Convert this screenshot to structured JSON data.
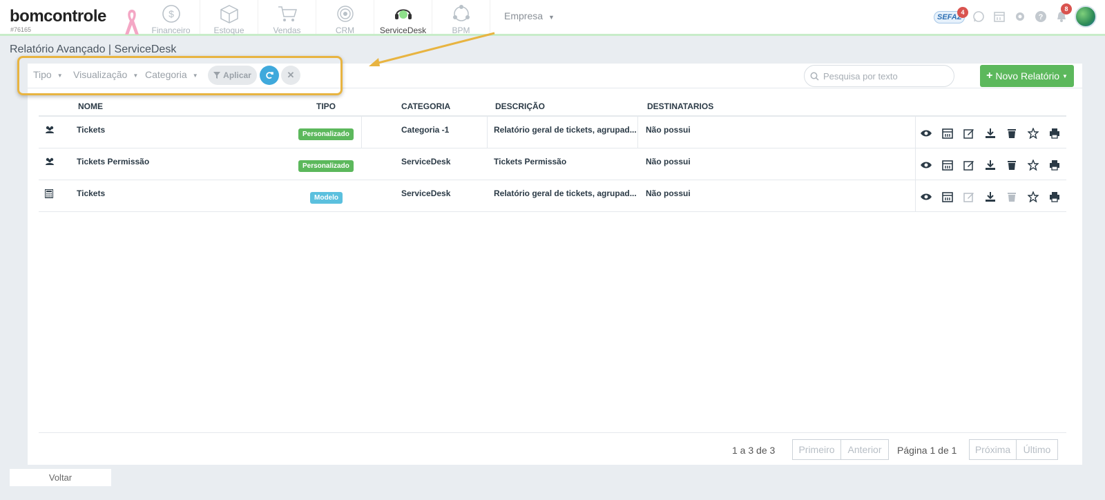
{
  "app": {
    "logo": "bomcontrole",
    "account_id": "#76165"
  },
  "modules": [
    {
      "label": "Financeiro",
      "icon": "dollar-coin-icon"
    },
    {
      "label": "Estoque",
      "icon": "box-icon"
    },
    {
      "label": "Vendas",
      "icon": "shopping-cart-icon"
    },
    {
      "label": "CRM",
      "icon": "target-icon"
    },
    {
      "label": "ServiceDesk",
      "icon": "headset-icon",
      "active": true
    },
    {
      "label": "BPM",
      "icon": "process-circle-icon"
    }
  ],
  "company_menu": "Empresa",
  "header_icons": {
    "sefaz_label": "SEFAZ",
    "sefaz_badge": "4",
    "notifications_badge": "8"
  },
  "page": {
    "title": "Relatório Avançado | ServiceDesk"
  },
  "toolbar": {
    "filters": [
      "Tipo",
      "Visualização",
      "Categoria"
    ],
    "apply_label": "Aplicar",
    "search_placeholder": "Pesquisa por texto",
    "new_report_label": "Novo Relatório"
  },
  "table": {
    "headers": {
      "name": "NOME",
      "type": "TIPO",
      "category": "CATEGORIA",
      "description": "DESCRIÇÃO",
      "recipients": "DESTINATARIOS"
    },
    "rows": [
      {
        "name": "Tickets",
        "type": "Personalizado",
        "category": "Categoria -1",
        "description": "Relatório geral de tickets, agrupad...",
        "recipients": "Não possui"
      },
      {
        "name": "Tickets Permissão",
        "type": "Personalizado",
        "category": "ServiceDesk",
        "description": "Tickets Permissão",
        "recipients": "Não possui"
      },
      {
        "name": "Tickets",
        "type": "Modelo",
        "category": "ServiceDesk",
        "description": "Relatório geral de tickets, agrupad...",
        "recipients": "Não possui"
      }
    ]
  },
  "pagination": {
    "count": "1 a 3 de 3",
    "first": "Primeiro",
    "previous": "Anterior",
    "page_info": "Página 1 de 1",
    "next": "Próxima",
    "last": "Último"
  },
  "footer": {
    "back_label": "Voltar"
  },
  "colors": {
    "accent_green": "#5cb85c",
    "tag_blue": "#5bc0de",
    "refresh_blue": "#3fa9dc",
    "highlight": "#e8b441"
  }
}
